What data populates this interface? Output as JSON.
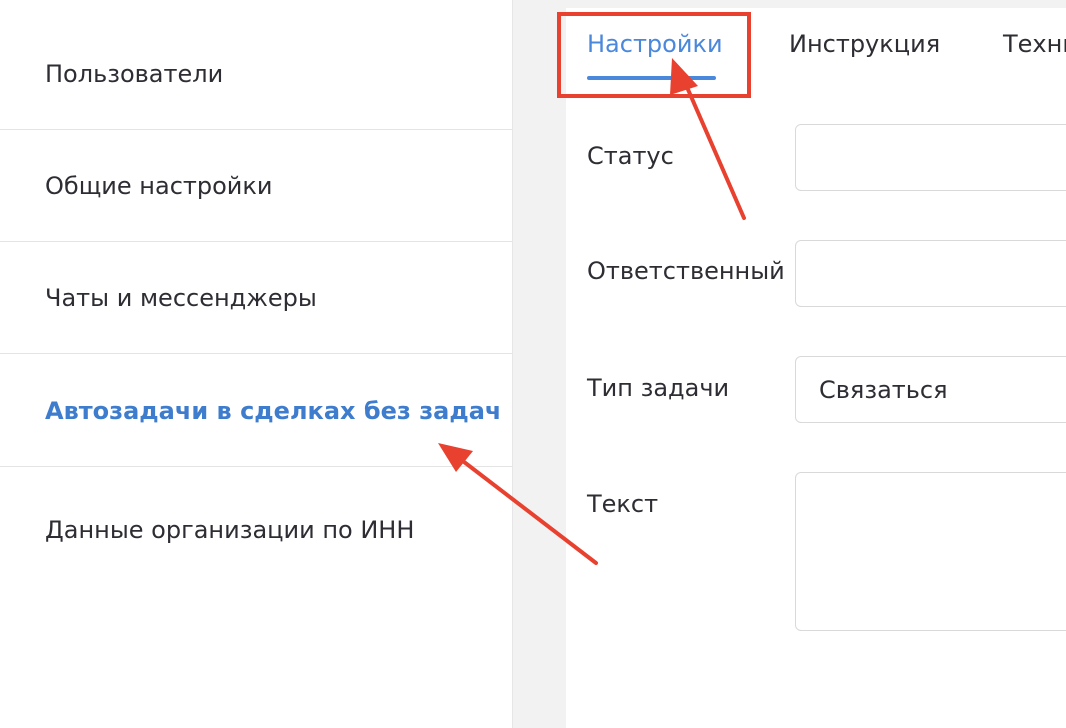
{
  "sidebar": {
    "items": [
      {
        "label": "Пользователи",
        "active": false
      },
      {
        "label": "Общие настройки",
        "active": false
      },
      {
        "label": "Чаты и мессенджеры",
        "active": false
      },
      {
        "label": "Автозадачи в сделках без задач",
        "active": true
      },
      {
        "label": "Данные организации по ИНН",
        "active": false
      }
    ]
  },
  "main": {
    "tabs": [
      {
        "label": "Настройки",
        "active": true
      },
      {
        "label": "Инструкция",
        "active": false
      },
      {
        "label": "Техни",
        "active": false
      }
    ],
    "form": {
      "status_label": "Статус",
      "status_value": "",
      "responsible_label": "Ответственный",
      "responsible_value": "",
      "task_type_label": "Тип задачи",
      "task_type_value": "Связаться",
      "text_label": "Текст",
      "text_value": ""
    }
  },
  "colors": {
    "accent": "#4a88dc",
    "active_link": "#3e7ccd",
    "annotation": "#e8412f",
    "text": "#2d2d33"
  }
}
